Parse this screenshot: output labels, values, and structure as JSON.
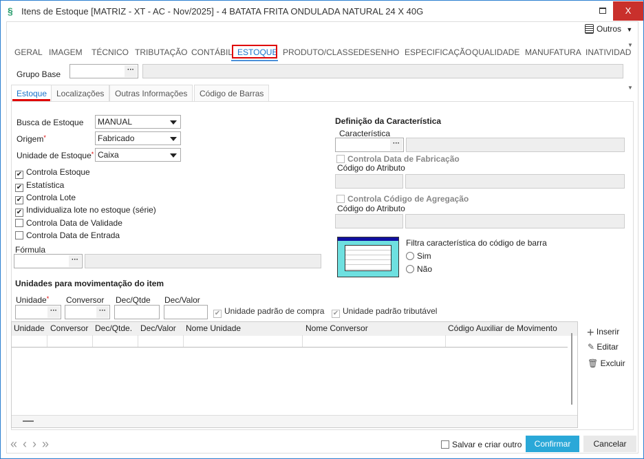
{
  "window": {
    "title": "Itens de Estoque [MATRIZ - XT - AC - Nov/2025]  - 4 BATATA FRITA ONDULADA NATURAL 24 X 40G",
    "close": "X"
  },
  "outros": "Outros",
  "tabs": [
    "GERAL",
    "IMAGEM",
    "TÉCNICO",
    "TRIBUTAÇÃO",
    "CONTÁBIL",
    "ESTOQUE",
    "PRODUTO/CLASSE",
    "DESENHO",
    "ESPECIFICAÇÃO",
    "QUALIDADE",
    "MANUFATURA",
    "INATIVIDAD"
  ],
  "grupo_base": {
    "label": "Grupo Base",
    "value": "",
    "desc": ""
  },
  "subtabs": [
    "Estoque",
    "Localizações",
    "Outras Informações",
    "Código de Barras"
  ],
  "left": {
    "busca": {
      "label": "Busca de Estoque",
      "value": "MANUAL"
    },
    "origem": {
      "label": "Origem",
      "value": "Fabricado"
    },
    "unidade": {
      "label": "Unidade de Estoque",
      "value": "Caixa"
    },
    "checks": [
      {
        "label": "Controla Estoque",
        "checked": true
      },
      {
        "label": "Estatística",
        "checked": true
      },
      {
        "label": "Controla Lote",
        "checked": true
      },
      {
        "label": "Individualiza lote no estoque (série)",
        "checked": true
      },
      {
        "label": "Controla Data de Validade",
        "checked": false
      },
      {
        "label": "Controla Data de Entrada",
        "checked": false
      }
    ],
    "formula": "Fórmula"
  },
  "right": {
    "heading": "Definição da Característica",
    "caracteristica": "Característica",
    "fabricacao": "Controla Data de Fabricação",
    "codigo1": "Código do Atributo",
    "agregacao": "Controla Código de Agregação",
    "codigo2": "Código do Atributo",
    "filtra": "Filtra característica do código de barra",
    "sim": "Sim",
    "nao": "Não"
  },
  "unidades": {
    "heading": "Unidades para movimentação do item",
    "unidade": "Unidade",
    "conversor": "Conversor",
    "dec_qtde": "Dec/Qtde",
    "dec_valor": "Dec/Valor",
    "padrao_compra": "Unidade padrão de compra",
    "padrao_tributavel": "Unidade padrão tributável",
    "columns": [
      "Unidade",
      "Conversor",
      "Dec/Qtde.",
      "Dec/Valor",
      "Nome Unidade",
      "Nome Conversor",
      "Código Auxiliar de Movimento"
    ],
    "inserir": "Inserir",
    "editar": "Editar",
    "excluir": "Excluir"
  },
  "footer": {
    "salvar": "Salvar e criar outro",
    "confirmar": "Confirmar",
    "cancelar": "Cancelar"
  },
  "colors": {
    "accent": "#2aa8d8",
    "red": "#e00000",
    "tab_blue": "#1a73c9"
  }
}
